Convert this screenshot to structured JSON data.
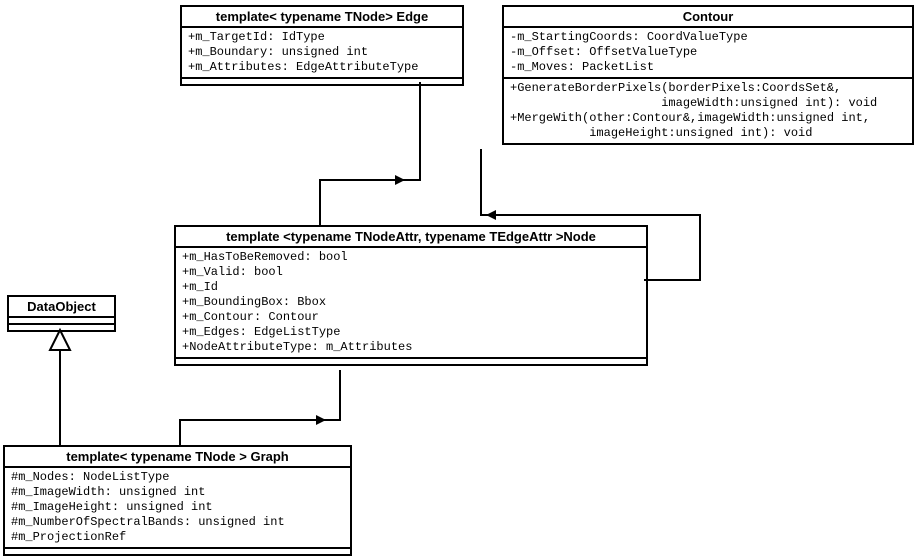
{
  "classes": {
    "edge": {
      "title": "template< typename TNode> Edge",
      "attrs": "+m_TargetId: IdType\n+m_Boundary: unsigned int\n+m_Attributes: EdgeAttributeType"
    },
    "contour": {
      "title": "Contour",
      "attrs": "-m_StartingCoords: CoordValueType\n-m_Offset: OffsetValueType\n-m_Moves: PacketList",
      "ops": "+GenerateBorderPixels(borderPixels:CoordsSet&,\n                     imageWidth:unsigned int): void\n+MergeWith(other:Contour&,imageWidth:unsigned int,\n           imageHeight:unsigned int): void"
    },
    "node": {
      "title": "template <typename TNodeAttr, typename TEdgeAttr >Node",
      "attrs": "+m_HasToBeRemoved: bool\n+m_Valid: bool\n+m_Id\n+m_BoundingBox: Bbox\n+m_Contour: Contour\n+m_Edges: EdgeListType\n+NodeAttributeType: m_Attributes"
    },
    "dataobject": {
      "title": "DataObject"
    },
    "graph": {
      "title": "template< typename TNode > Graph",
      "attrs": "#m_Nodes: NodeListType\n#m_ImageWidth: unsigned int\n#m_ImageHeight: unsigned int\n#m_NumberOfSpectralBands: unsigned int\n#m_ProjectionRef"
    }
  },
  "chart_data": {
    "type": "uml-class-diagram",
    "classes": [
      {
        "name": "Edge",
        "template": "template< typename TNode>",
        "attributes": [
          {
            "vis": "+",
            "name": "m_TargetId",
            "type": "IdType"
          },
          {
            "vis": "+",
            "name": "m_Boundary",
            "type": "unsigned int"
          },
          {
            "vis": "+",
            "name": "m_Attributes",
            "type": "EdgeAttributeType"
          }
        ],
        "operations": []
      },
      {
        "name": "Contour",
        "attributes": [
          {
            "vis": "-",
            "name": "m_StartingCoords",
            "type": "CoordValueType"
          },
          {
            "vis": "-",
            "name": "m_Offset",
            "type": "OffsetValueType"
          },
          {
            "vis": "-",
            "name": "m_Moves",
            "type": "PacketList"
          }
        ],
        "operations": [
          {
            "vis": "+",
            "signature": "GenerateBorderPixels(borderPixels:CoordsSet&, imageWidth:unsigned int): void"
          },
          {
            "vis": "+",
            "signature": "MergeWith(other:Contour&, imageWidth:unsigned int, imageHeight:unsigned int): void"
          }
        ]
      },
      {
        "name": "Node",
        "template": "template <typename TNodeAttr, typename TEdgeAttr >",
        "attributes": [
          {
            "vis": "+",
            "name": "m_HasToBeRemoved",
            "type": "bool"
          },
          {
            "vis": "+",
            "name": "m_Valid",
            "type": "bool"
          },
          {
            "vis": "+",
            "name": "m_Id",
            "type": ""
          },
          {
            "vis": "+",
            "name": "m_BoundingBox",
            "type": "Bbox"
          },
          {
            "vis": "+",
            "name": "m_Contour",
            "type": "Contour"
          },
          {
            "vis": "+",
            "name": "m_Edges",
            "type": "EdgeListType"
          },
          {
            "vis": "+",
            "name": "NodeAttributeType",
            "type": "m_Attributes"
          }
        ],
        "operations": []
      },
      {
        "name": "DataObject",
        "attributes": [],
        "operations": []
      },
      {
        "name": "Graph",
        "template": "template< typename TNode >",
        "attributes": [
          {
            "vis": "#",
            "name": "m_Nodes",
            "type": "NodeListType"
          },
          {
            "vis": "#",
            "name": "m_ImageWidth",
            "type": "unsigned int"
          },
          {
            "vis": "#",
            "name": "m_ImageHeight",
            "type": "unsigned int"
          },
          {
            "vis": "#",
            "name": "m_NumberOfSpectralBands",
            "type": "unsigned int"
          },
          {
            "vis": "#",
            "name": "m_ProjectionRef",
            "type": ""
          }
        ],
        "operations": []
      }
    ],
    "relationships": [
      {
        "from": "Node",
        "to": "Edge",
        "type": "association-arrow"
      },
      {
        "from": "Node",
        "to": "Contour",
        "type": "association-arrow"
      },
      {
        "from": "Graph",
        "to": "Node",
        "type": "association-arrow"
      },
      {
        "from": "Graph",
        "to": "DataObject",
        "type": "generalization"
      }
    ]
  }
}
